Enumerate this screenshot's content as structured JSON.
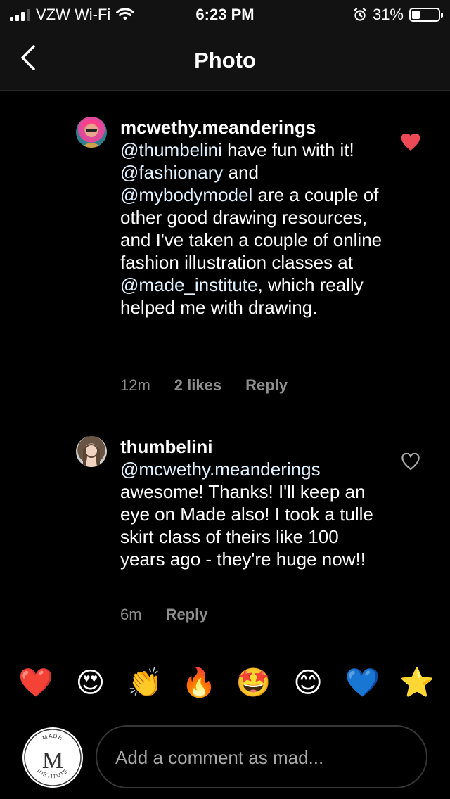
{
  "status_bar": {
    "carrier": "VZW Wi-Fi",
    "time": "6:23 PM",
    "battery": "31%",
    "battery_level": 0.31
  },
  "nav": {
    "title": "Photo"
  },
  "comments": [
    {
      "username": "mcwethy.meanderings",
      "segments": [
        {
          "text": "@thumbelini",
          "mention": true
        },
        {
          "text": " have fun with it!  ",
          "mention": false
        },
        {
          "text": "@fashionary",
          "mention": true
        },
        {
          "text": " and ",
          "mention": false
        },
        {
          "text": "@mybodymodel",
          "mention": true
        },
        {
          "text": " are a couple of other good drawing resources, and I've taken a couple of online fashion illustration classes at ",
          "mention": false
        },
        {
          "text": "@made_institute",
          "mention": true
        },
        {
          "text": ", which really helped me with drawing.",
          "mention": false
        }
      ],
      "time": "12m",
      "likes": "2 likes",
      "reply": "Reply",
      "liked": true
    },
    {
      "username": "thumbelini",
      "segments": [
        {
          "text": "@mcwethy.meanderings",
          "mention": true
        },
        {
          "text": " awesome! Thanks! I'll keep an eye on Made also! I took a tulle skirt class of theirs like 100 years ago - they're huge now!!",
          "mention": false
        }
      ],
      "time": "6m",
      "likes": "",
      "reply": "Reply",
      "liked": false
    }
  ],
  "emoji_bar": [
    "❤️",
    "😍",
    "👏",
    "🔥",
    "🤩",
    "😊",
    "💙",
    "⭐"
  ],
  "composer": {
    "placeholder": "Add a comment as mad...",
    "avatar_text_top": "MADE",
    "avatar_text_bottom": "INSTITUTE",
    "avatar_monogram": "M"
  },
  "colors": {
    "heart_liked": "#ed4956",
    "mention": "#e0f1ff",
    "muted": "#8e8e8e"
  }
}
